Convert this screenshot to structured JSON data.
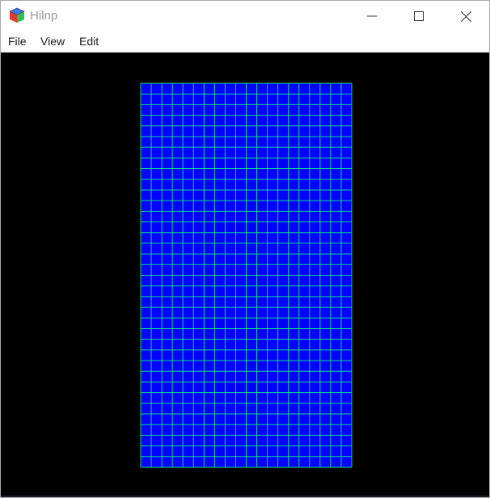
{
  "window": {
    "title": "Hilnp",
    "icon": "cube-icon"
  },
  "menu": {
    "items": [
      {
        "label": "File"
      },
      {
        "label": "View"
      },
      {
        "label": "Edit"
      }
    ]
  },
  "viewport": {
    "background": "#000000",
    "mesh": {
      "columns": 20,
      "rows": 36,
      "fill_color": "#0000ff",
      "line_color": "#00d98a"
    }
  }
}
